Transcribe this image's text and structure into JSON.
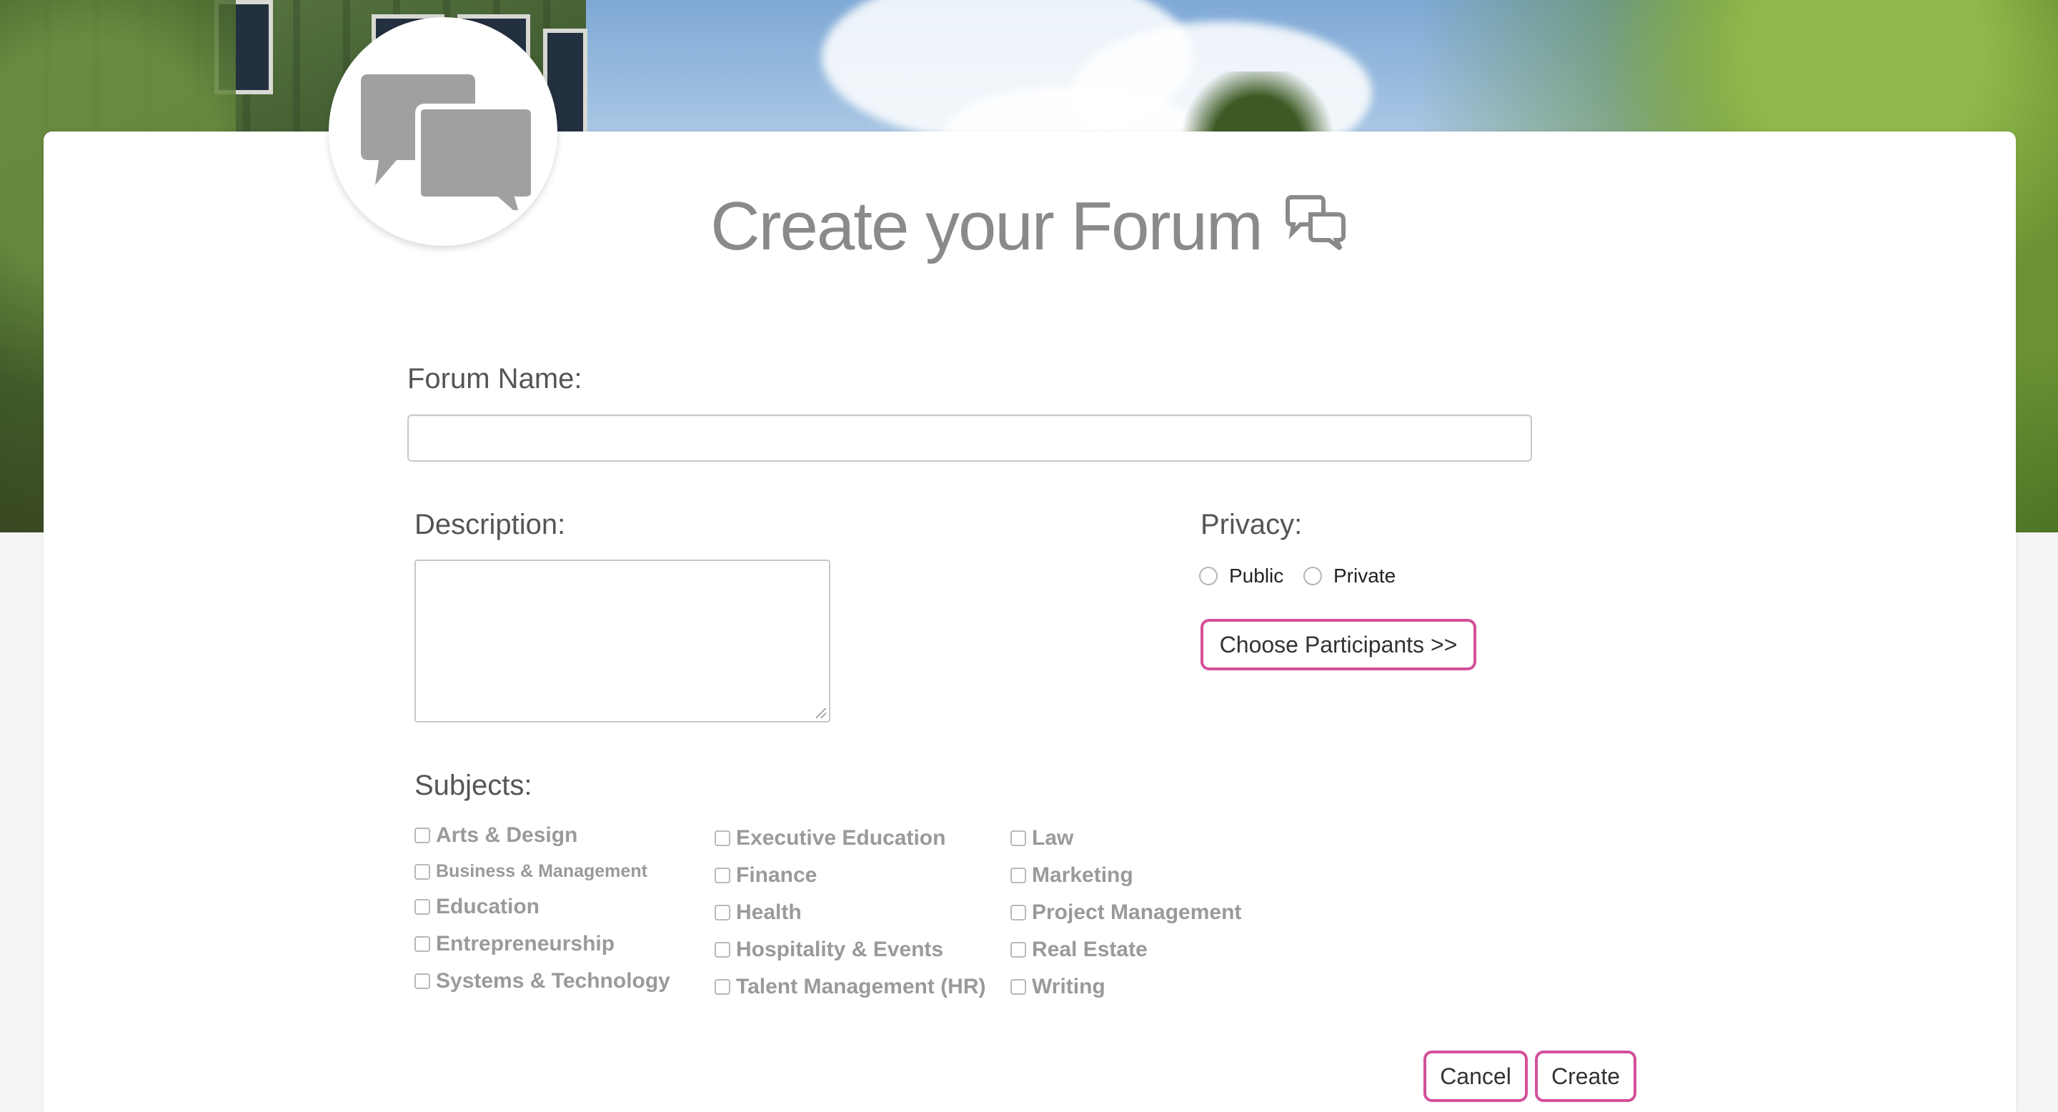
{
  "page": {
    "title": "Create your Forum"
  },
  "form": {
    "forum_name_label": "Forum Name:",
    "forum_name_value": "",
    "description_label": "Description:",
    "description_value": "",
    "privacy_label": "Privacy:",
    "privacy_options": [
      "Public",
      "Private"
    ],
    "choose_participants_label": "Choose Participants >>",
    "subjects_label": "Subjects:",
    "subjects": [
      [
        "Arts & Design",
        "Business & Management",
        "Education",
        "Entrepreneurship",
        "Systems & Technology"
      ],
      [
        "Executive Education",
        "Finance",
        "Health",
        "Hospitality & Events",
        "Talent Management (HR)"
      ],
      [
        "Law",
        "Marketing",
        "Project Management",
        "Real Estate",
        "Writing"
      ]
    ],
    "cancel_label": "Cancel",
    "create_label": "Create"
  },
  "colors": {
    "accent": "#d4509a",
    "title_text": "#8a8a8a",
    "subject_text": "#9a9a9a"
  },
  "icons": {
    "avatar": "chat-bubbles-icon",
    "title": "chat-bubbles-outline-icon"
  }
}
